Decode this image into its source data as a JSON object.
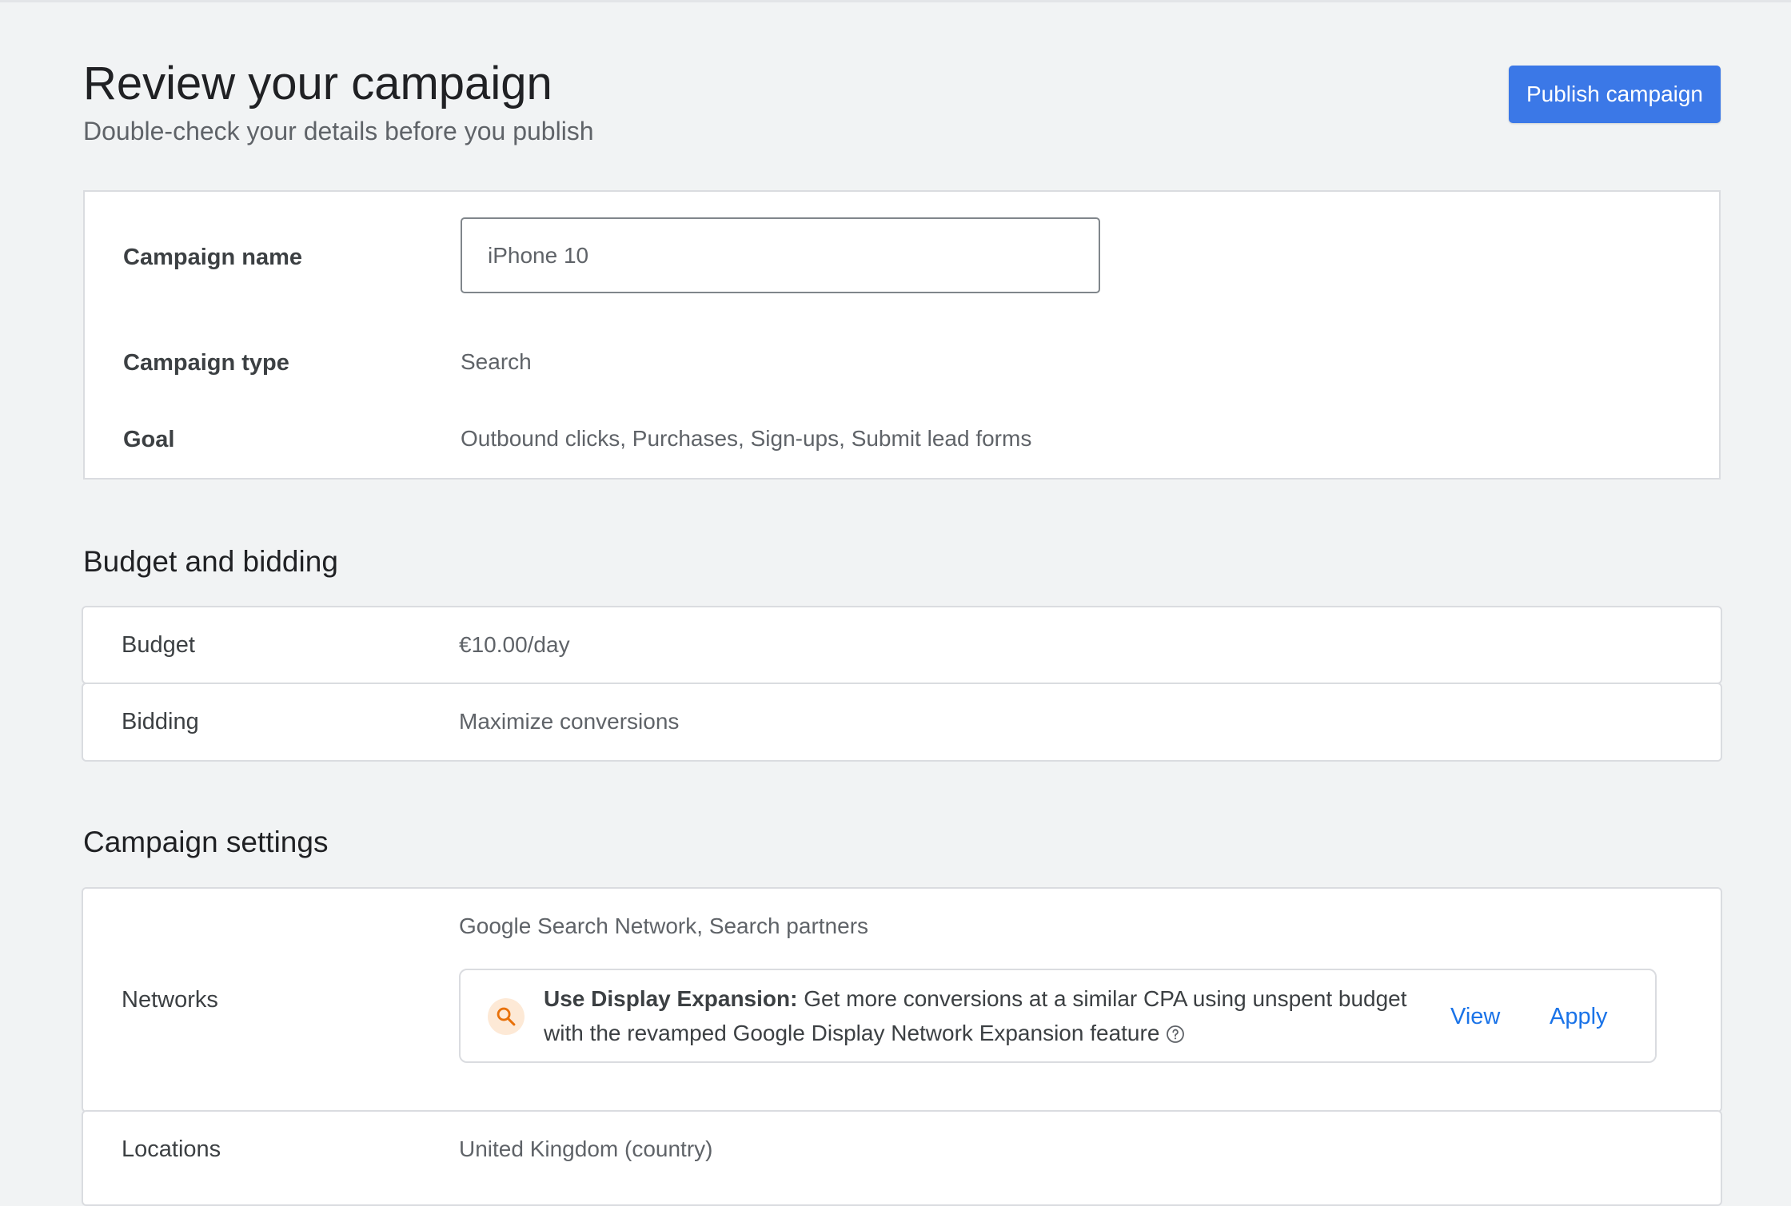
{
  "header": {
    "title": "Review your campaign",
    "subtitle": "Double-check your details before you publish",
    "publish_label": "Publish campaign"
  },
  "overview": {
    "campaign_name_label": "Campaign name",
    "campaign_name_value": "iPhone 10",
    "campaign_type_label": "Campaign type",
    "campaign_type_value": "Search",
    "goal_label": "Goal",
    "goal_value": "Outbound clicks, Purchases, Sign-ups, Submit lead forms"
  },
  "budget_section": {
    "title": "Budget and bidding",
    "budget_label": "Budget",
    "budget_value": "€10.00/day",
    "bidding_label": "Bidding",
    "bidding_value": "Maximize conversions"
  },
  "settings_section": {
    "title": "Campaign settings",
    "networks_label": "Networks",
    "networks_value": "Google Search Network, Search partners",
    "recommendation": {
      "icon": "search-icon",
      "title": "Use Display Expansion:",
      "text": "Get more conversions at a similar CPA using unspent budget with the revamped Google Display Network Expansion feature",
      "view_label": "View",
      "apply_label": "Apply"
    },
    "locations_label": "Locations",
    "locations_value": "United Kingdom (country)"
  },
  "colors": {
    "primary": "#3b78e7",
    "link": "#1a73e8",
    "background": "#f1f3f4",
    "recommendation_icon_bg": "#fde9d6",
    "recommendation_icon": "#e8710a"
  }
}
